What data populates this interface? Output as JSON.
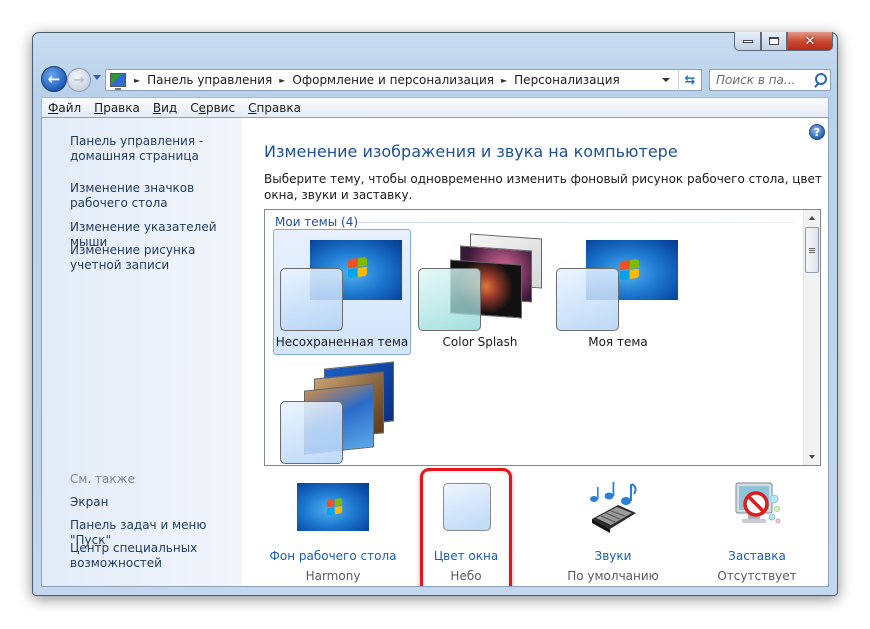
{
  "window": {
    "caption_buttons": {
      "minimize": "minimize",
      "maximize": "maximize",
      "close": "close"
    }
  },
  "navigation": {
    "back_icon": "←",
    "forward_icon": "→",
    "refresh_icon": "⇆",
    "breadcrumb": [
      "Панель управления",
      "Оформление и персонализация",
      "Персонализация"
    ],
    "breadcrumb_separator": "►",
    "search_placeholder": "Поиск в па..."
  },
  "menu": {
    "items": [
      {
        "first": "Ф",
        "rest": "айл"
      },
      {
        "first": "П",
        "rest": "равка"
      },
      {
        "first": "В",
        "rest": "ид"
      },
      {
        "first": "С",
        "u": "е",
        "rest": "рвис",
        "pre": "С"
      },
      {
        "first": "С",
        "rest": "правка"
      }
    ],
    "labels": [
      "Файл",
      "Правка",
      "Вид",
      "Сервис",
      "Справка"
    ]
  },
  "sidebar": {
    "links": [
      "Панель управления - домашняя страница",
      "Изменение значков рабочего стола",
      "Изменение указателей мыши",
      "Изменение рисунка учетной записи"
    ],
    "see_also_heading": "См. также",
    "see_also": [
      "Экран",
      "Панель задач и меню \"Пуск\"",
      "Центр специальных возможностей"
    ]
  },
  "main": {
    "help_icon": "?",
    "title": "Изменение изображения и звука на компьютере",
    "description": "Выберите тему, чтобы одновременно изменить фоновый рисунок рабочего стола, цвет окна, звуки и заставку.",
    "group_header": "Мои темы (4)",
    "themes": [
      {
        "name": "Несохраненная тема",
        "selected": true
      },
      {
        "name": "Color Splash",
        "selected": false
      },
      {
        "name": "Моя тема",
        "selected": false
      },
      {
        "name": "",
        "selected": false
      }
    ],
    "options": [
      {
        "label": "Фон рабочего стола",
        "value": "Harmony"
      },
      {
        "label": "Цвет окна",
        "value": "Небо",
        "highlighted": true
      },
      {
        "label": "Звуки",
        "value": "По умолчанию"
      },
      {
        "label": "Заставка",
        "value": "Отсутствует"
      }
    ],
    "highlight_color": "#e8141b",
    "link_color": "#1a5fb4",
    "title_color": "#1e5096"
  }
}
